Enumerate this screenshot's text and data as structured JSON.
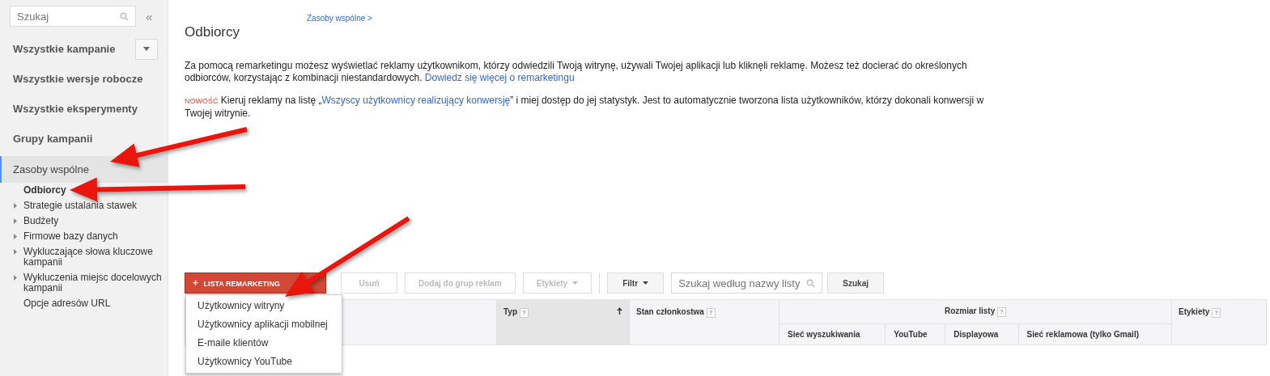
{
  "sidebar": {
    "search": {
      "placeholder": "Szukaj"
    },
    "collapse": "«",
    "nav": [
      {
        "label": "Wszystkie kampanie",
        "selected": false,
        "has_menu": true
      },
      {
        "label": "Wszystkie wersje robocze",
        "selected": false,
        "has_menu": false
      },
      {
        "label": "Wszystkie eksperymenty",
        "selected": false,
        "has_menu": false
      },
      {
        "label": "Grupy kampanii",
        "selected": false,
        "has_menu": false
      },
      {
        "label": "Zasoby wspólne",
        "selected": true,
        "has_menu": false
      }
    ],
    "sub_items": [
      {
        "label": "Odbiorcy",
        "selected": true,
        "expandable": false
      },
      {
        "label": "Strategie ustalania stawek",
        "selected": false,
        "expandable": true
      },
      {
        "label": "Budżety",
        "selected": false,
        "expandable": true
      },
      {
        "label": "Firmowe bazy danych",
        "selected": false,
        "expandable": true
      },
      {
        "label": "Wykluczające słowa kluczowe kampanii",
        "selected": false,
        "expandable": true
      },
      {
        "label": "Wykluczenia miejsc docelowych kampanii",
        "selected": false,
        "expandable": true
      },
      {
        "label": "Opcje adresów URL",
        "selected": false,
        "expandable": false
      }
    ]
  },
  "breadcrumb": "Zasoby wspólne >",
  "title": "Odbiorcy",
  "intro": {
    "text": "Za pomocą remarketingu możesz wyświetlać reklamy użytkownikom, którzy odwiedzili Twoją witrynę, używali Twojej aplikacji lub kliknęli reklamę. Możesz też docierać do określonych odbiorców, korzystając z kombinacji niestandardowych.",
    "link": "Dowiedz się więcej o remarketingu"
  },
  "notice": {
    "badge": "NOWOŚĆ",
    "before": "Kieruj reklamy na listę „",
    "link": "Wszyscy użytkownicy realizujący konwersję",
    "after": "” i miej dostęp do jej statystyk. Jest to automatycznie tworzona lista użytkowników, którzy dokonali konwersji w Twojej witrynie."
  },
  "toolbar": {
    "primary": {
      "label": "LISTA REMARKETING",
      "icon": "+"
    },
    "buttons": [
      {
        "label": "Usuń",
        "disabled": true,
        "caret": false
      },
      {
        "label": "Dodaj do grup reklam",
        "disabled": true,
        "caret": false
      },
      {
        "label": "Etykiety",
        "disabled": true,
        "caret": true
      }
    ],
    "filter": {
      "label": "Filtr",
      "disabled": false,
      "caret": true
    },
    "search": {
      "placeholder": "Szukaj według nazwy listy"
    },
    "search_button": "Szukaj"
  },
  "menu": [
    "Użytkownicy witryny",
    "Użytkownicy aplikacji mobilnej",
    "E-maile klientów",
    "Użytkownicy YouTube"
  ],
  "table": {
    "columns": [
      {
        "label": "Typ",
        "help": "?",
        "sorted": true
      },
      {
        "label": "Stan członkostwa",
        "help": "?",
        "sorted": false
      }
    ],
    "group": {
      "label": "Rozmiar listy",
      "help": "?"
    },
    "sub_columns": [
      "Sieć wyszukiwania",
      "YouTube",
      "Displayowa",
      "Sieć reklamowa (tylko Gmail)"
    ],
    "last": {
      "label": "Etykiety",
      "help": "?"
    }
  }
}
